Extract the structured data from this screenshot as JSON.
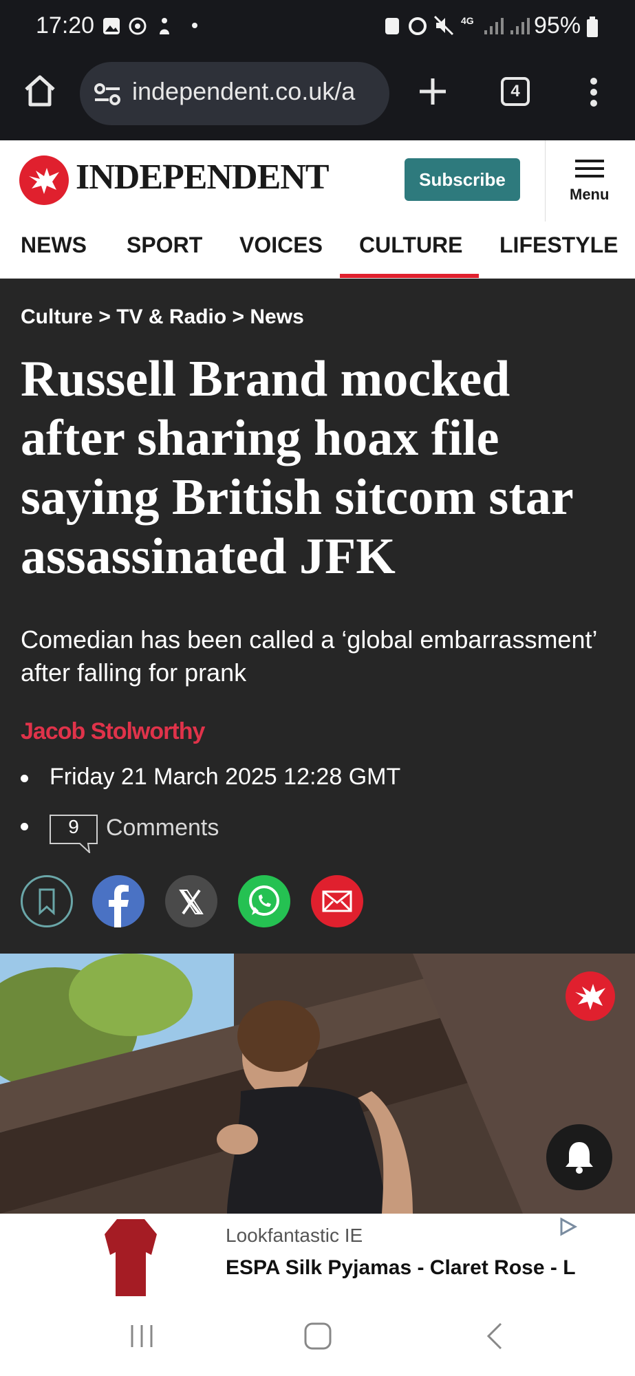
{
  "status_bar": {
    "time": "17:20",
    "battery": "95%",
    "network": "4G"
  },
  "browser": {
    "url": "independent.co.uk/a",
    "tab_count": "4"
  },
  "header": {
    "logo_text": "INDEPENDENT",
    "subscribe_label": "Subscribe",
    "menu_label": "Menu"
  },
  "nav": {
    "items": [
      {
        "label": "NEWS"
      },
      {
        "label": "SPORT"
      },
      {
        "label": "VOICES"
      },
      {
        "label": "CULTURE",
        "active": true
      },
      {
        "label": "LIFESTYLE"
      }
    ]
  },
  "article": {
    "breadcrumb": "Culture > TV & Radio > News",
    "headline": "Russell Brand mocked after sharing hoax file saying British sitcom star assassinated JFK",
    "standfirst": "Comedian has been called a ‘global embarrassment’ after falling for prank",
    "author": "Jacob Stolworthy",
    "date": "Friday 21 March 2025 12:28 GMT",
    "comment_count": "9",
    "comments_label": "Comments",
    "share_icons": [
      "bookmark-icon",
      "facebook-icon",
      "x-icon",
      "whatsapp-icon",
      "email-icon"
    ]
  },
  "ad": {
    "advertiser": "Lookfantastic IE",
    "title": "ESPA Silk Pyjamas - Claret Rose - L"
  },
  "colors": {
    "brand_red": "#e0202e",
    "subscribe_teal": "#2e7a7d",
    "article_bg": "#262626",
    "byline_red": "#e0334a"
  }
}
